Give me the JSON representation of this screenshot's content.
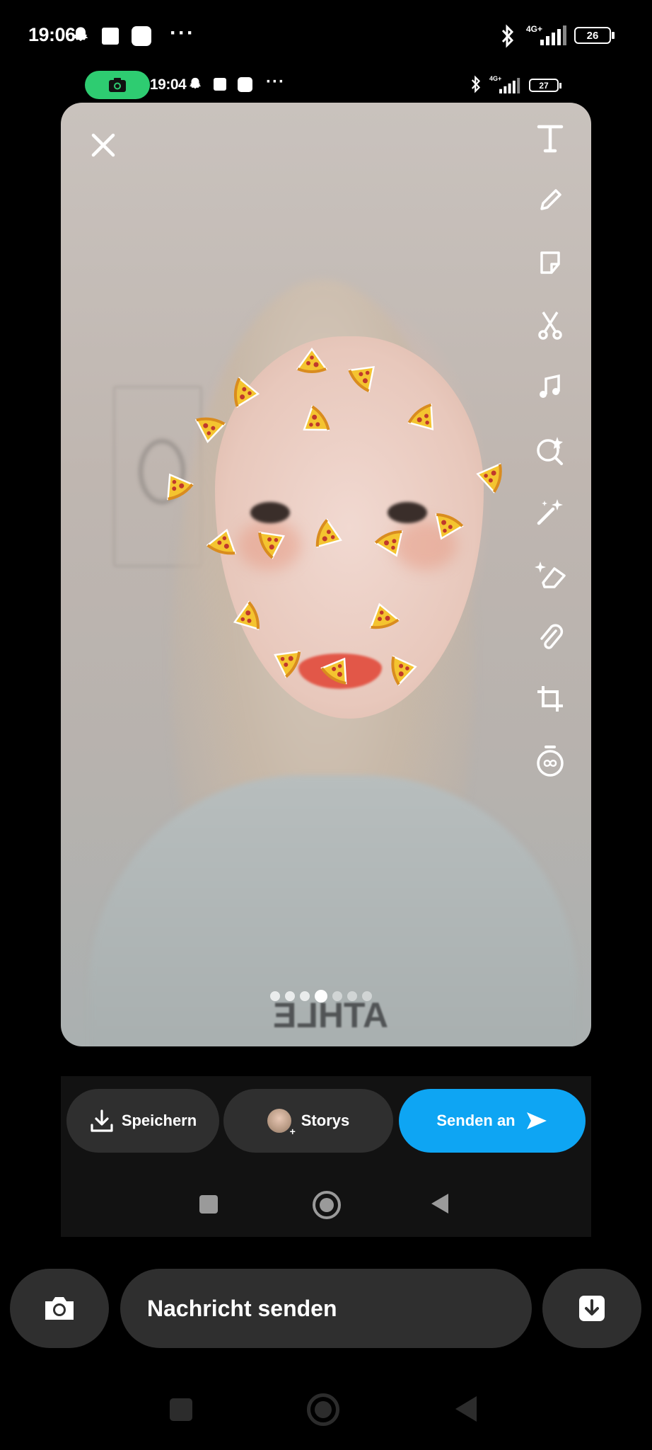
{
  "outer_status": {
    "time": "19:06",
    "battery": "26",
    "network": "4G+"
  },
  "inner_status": {
    "time": "19:04",
    "battery": "27",
    "network": "4G+"
  },
  "tools": [
    "text-icon",
    "pencil-icon",
    "sticker-icon",
    "scissors-icon",
    "music-icon",
    "lens-icon",
    "magic-wand-icon",
    "eraser-icon",
    "paperclip-icon",
    "crop-icon",
    "timer-icon"
  ],
  "pagination": {
    "total": 7,
    "active": 3
  },
  "actions": {
    "save_label": "Speichern",
    "story_label": "Storys",
    "send_label": "Senden an"
  },
  "message": {
    "placeholder": "Nachricht senden"
  },
  "shirt_text": "ATHLE",
  "colors": {
    "accent_blue": "#0ea5f3",
    "record_green": "#2ecc71",
    "pill_dark": "#2f2f2f"
  }
}
